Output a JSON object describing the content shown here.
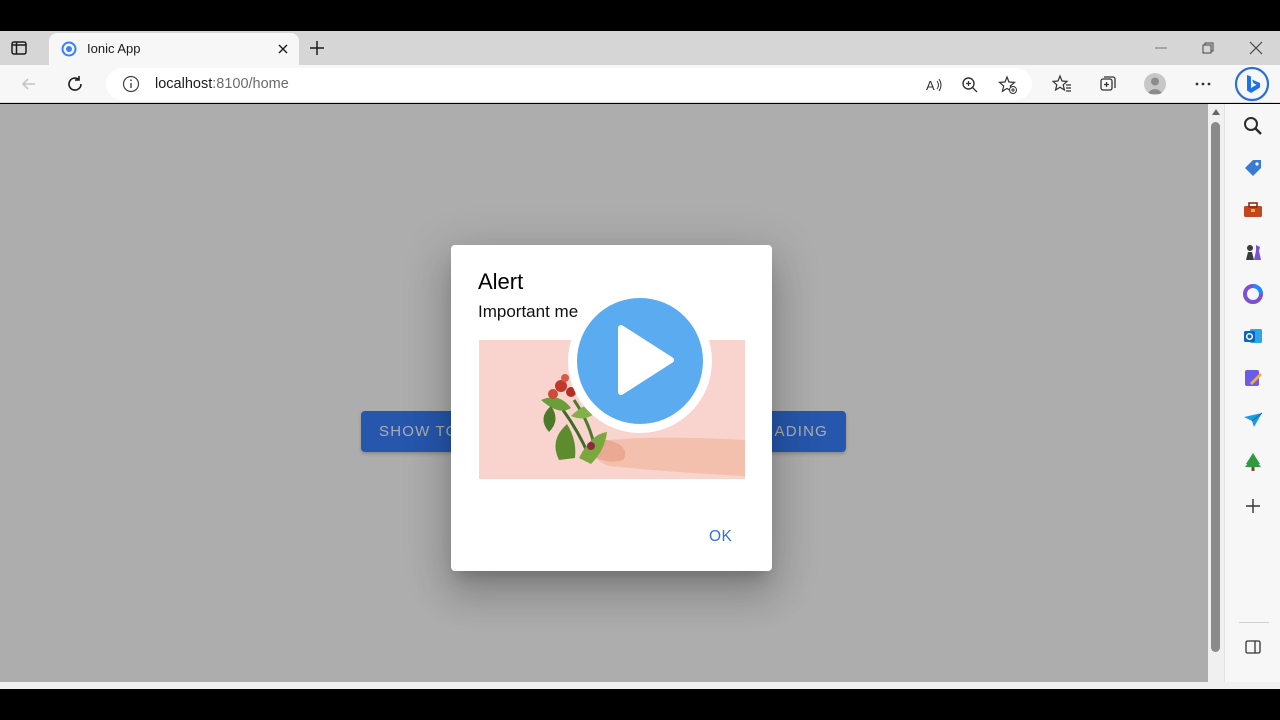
{
  "browser": {
    "tab_title": "Ionic App",
    "url_host": "localhost",
    "url_path": ":8100/home"
  },
  "page": {
    "button_left_label": "SHOW TO",
    "button_right_label": "ADING"
  },
  "alert": {
    "header": "Alert",
    "message": "Important me",
    "ok_label": "OK"
  },
  "colors": {
    "primary": "#3880ff",
    "alert_button": "#3171e0",
    "play_blue": "#5aabf0",
    "image_background": "#f9d3cd"
  },
  "icons": {
    "sidebar": [
      "search-icon",
      "tag-icon",
      "toolbox-icon",
      "chess-icon",
      "microsoft365-icon",
      "outlook-icon",
      "drop-icon",
      "send-icon",
      "tree-icon",
      "add-icon",
      "sidebar-panel-icon"
    ],
    "toolbar": [
      "read-aloud-icon",
      "zoom-icon",
      "add-favorite-icon",
      "favorites-icon",
      "collections-icon",
      "profile-avatar",
      "more-icon",
      "bing-icon"
    ]
  }
}
